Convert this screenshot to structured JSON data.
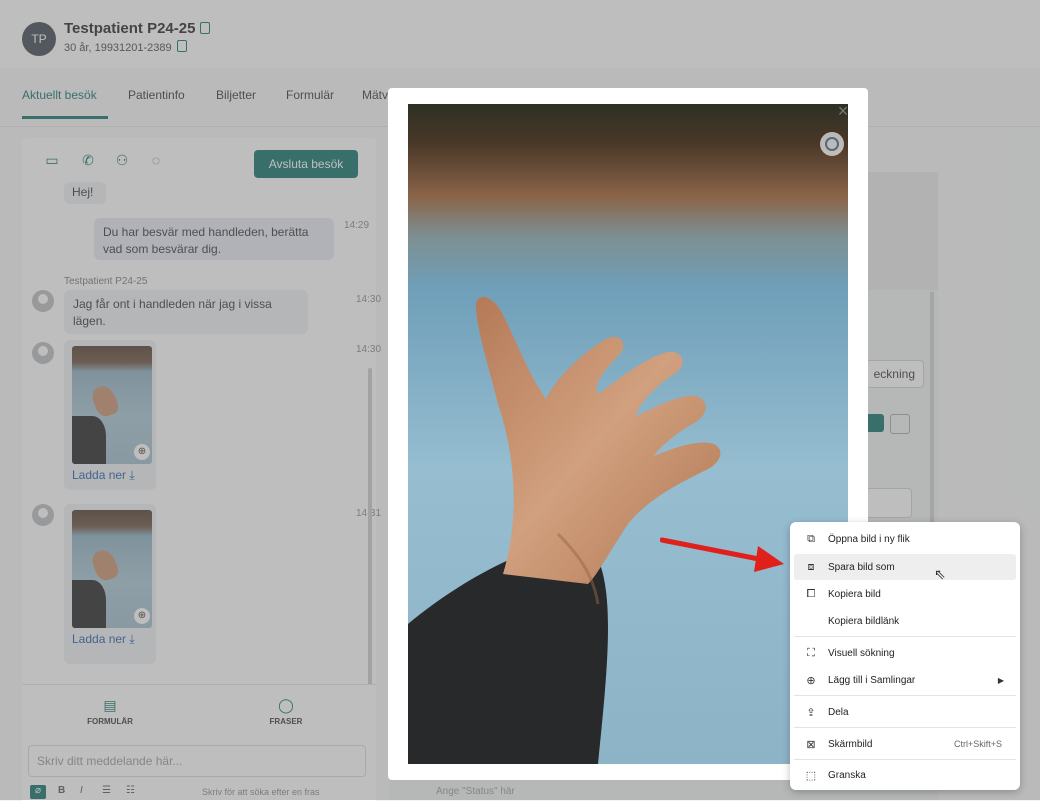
{
  "header": {
    "avatar_initials": "TP",
    "patient_name": "Testpatient P24-25",
    "patient_meta": "30 år, 19931201-2389"
  },
  "tabs": [
    {
      "label": "Aktuellt besök",
      "active": true
    },
    {
      "label": "Patientinfo",
      "active": false
    },
    {
      "label": "Biljetter",
      "active": false
    },
    {
      "label": "Formulär",
      "active": false
    },
    {
      "label": "Mätv",
      "active": false
    }
  ],
  "chat": {
    "end_visit_label": "Avsluta besök",
    "messages": {
      "greeting": "Hej!",
      "doctor_msg": "Du har besvär med handleden, berätta vad som besvärar dig.",
      "doctor_time": "14:29",
      "patient_sender": "Testpatient P24-25",
      "patient_msg": "Jag får ont i handleden när jag i vissa lägen.",
      "patient_time": "14:30",
      "image1_time": "14:30",
      "image2_time": "14:31",
      "download_label": "Ladda ner"
    },
    "bottom": {
      "form_label": "FORMULÄR",
      "phrases_label": "FRASER",
      "input_placeholder": "Skriv ditt meddelande här...",
      "hint": "Skriv  för att söka efter en fras"
    }
  },
  "background": {
    "right_button_partial": "eckning",
    "status_placeholder": "Ange \"Status\" här"
  },
  "context_menu": {
    "items": [
      {
        "label": "Öppna bild i ny flik",
        "icon": "new-tab-icon"
      },
      {
        "label": "Spara bild som",
        "icon": "save-image-icon",
        "highlighted": true
      },
      {
        "label": "Kopiera bild",
        "icon": "copy-image-icon"
      },
      {
        "label": "Kopiera bildlänk",
        "icon": ""
      },
      {
        "label": "Visuell sökning",
        "icon": "visual-search-icon"
      },
      {
        "label": "Lägg till i Samlingar",
        "icon": "collections-icon",
        "submenu": true
      },
      {
        "label": "Dela",
        "icon": "share-icon"
      },
      {
        "label": "Skärmbild",
        "icon": "screenshot-icon",
        "shortcut": "Ctrl+Skift+S"
      },
      {
        "label": "Granska",
        "icon": "inspect-icon"
      }
    ]
  },
  "colors": {
    "brand": "#0e6f68",
    "annotation_arrow": "#e0201b"
  }
}
